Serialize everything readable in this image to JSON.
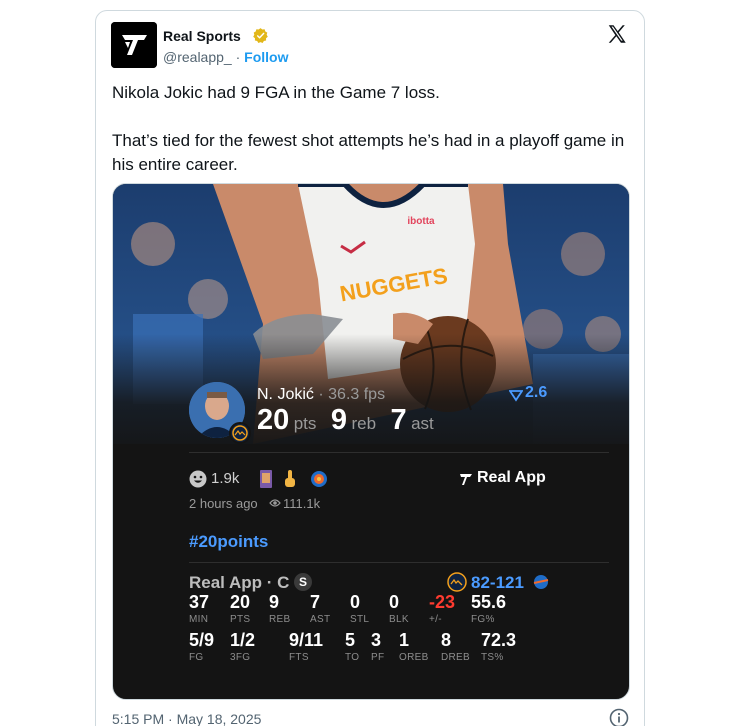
{
  "author": {
    "name": "Real Sports",
    "handle": "@realapp_",
    "separator": "·",
    "follow_label": "Follow"
  },
  "tweet": {
    "paragraphs": [
      "Nikola Jokic had 9 FGA in the Game 7 loss.",
      "That’s tied for the fewest shot attempts he’s had in a playoff game in his entire career."
    ],
    "timestamp": "5:15 PM · May 18, 2025"
  },
  "media": {
    "jersey_text": "NUGGETS",
    "sponsor_text": "ibotta",
    "player_line": {
      "name": "N. Jokić",
      "sep": "·",
      "fps": "36.3 fps",
      "score_change": "2.6"
    },
    "headline_stats": [
      {
        "value": "20",
        "label": "pts"
      },
      {
        "value": "9",
        "label": "reb"
      },
      {
        "value": "7",
        "label": "ast"
      }
    ],
    "reactions": {
      "count": "1.9k",
      "posted": "2 hours ago",
      "views": "111.1k",
      "brand": "Real App"
    },
    "hashtag": "#20points",
    "game": {
      "source": "Real App · C",
      "badge": "S",
      "score": "82-121"
    },
    "box_row1": [
      {
        "value": "37",
        "label": "MIN"
      },
      {
        "value": "20",
        "label": "PTS"
      },
      {
        "value": "9",
        "label": "REB"
      },
      {
        "value": "7",
        "label": "AST"
      },
      {
        "value": "0",
        "label": "STL"
      },
      {
        "value": "0",
        "label": "BLK"
      },
      {
        "value": "-23",
        "label": "+/-"
      },
      {
        "value": "55.6",
        "label": "FG%"
      }
    ],
    "box_row2": [
      {
        "value": "5/9",
        "label": "FG"
      },
      {
        "value": "1/2",
        "label": "3FG"
      },
      {
        "value": "9/11",
        "label": "FTS"
      },
      {
        "value": "5",
        "label": "TO"
      },
      {
        "value": "3",
        "label": "PF"
      },
      {
        "value": "1",
        "label": "OREB"
      },
      {
        "value": "8",
        "label": "DREB"
      },
      {
        "value": "72.3",
        "label": "TS%"
      }
    ]
  },
  "colors": {
    "accent": "#1d9bf0",
    "media_bg": "#141414",
    "negative": "#ff3b30",
    "stat_blue": "#4b9bff"
  },
  "icons": [
    "x-logo-icon",
    "verified-badge-icon",
    "smile-reaction-icon",
    "eye-icon",
    "info-icon",
    "nuggets-logo-icon",
    "thunder-logo-icon",
    "trend-arrow-icon"
  ]
}
